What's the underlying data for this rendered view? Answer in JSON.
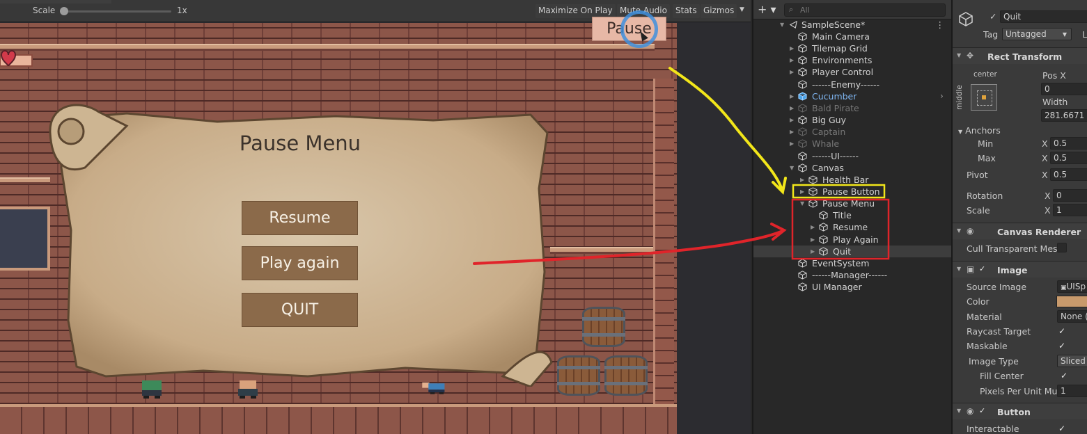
{
  "colors": {
    "accent_yellow": "#f2e61a",
    "accent_red": "#e0242a",
    "selection_blue": "#3f8fdd",
    "scroll_parchment": "#d8c3a4",
    "menu_button": "#8b6a4a"
  },
  "game_toolbar": {
    "scale_label": "Scale",
    "scale_value": "1x",
    "maximize_label": "Maximize On Play",
    "mute_label": "Mute Audio",
    "stats_label": "Stats",
    "gizmos_label": "Gizmos",
    "gizmos_dropdown": "▼"
  },
  "game": {
    "pause_button": "Pause",
    "menu_title": "Pause Menu",
    "resume": "Resume",
    "play_again": "Play again",
    "quit": "QUIT"
  },
  "hierarchy": {
    "add_label": "+ ▾",
    "search_placeholder": "All",
    "scene": "SampleScene*",
    "items": [
      {
        "label": "Main Camera"
      },
      {
        "label": "Tilemap Grid"
      },
      {
        "label": "Environments"
      },
      {
        "label": "Player Control"
      },
      {
        "label": "------Enemy------"
      },
      {
        "label": "Cucumber"
      },
      {
        "label": "Bald Pirate"
      },
      {
        "label": "Big Guy"
      },
      {
        "label": "Captain"
      },
      {
        "label": "Whale"
      },
      {
        "label": "------UI------"
      },
      {
        "label": "Canvas"
      },
      {
        "label": "Health Bar"
      },
      {
        "label": "Pause Button"
      },
      {
        "label": "Pause Menu"
      },
      {
        "label": "Title"
      },
      {
        "label": "Resume"
      },
      {
        "label": "Play Again"
      },
      {
        "label": "Quit"
      },
      {
        "label": "EventSystem"
      },
      {
        "label": "------Manager------"
      },
      {
        "label": "UI Manager"
      }
    ]
  },
  "inspector": {
    "object_name": "Quit",
    "tag_label": "Tag",
    "tag_value": "Untagged",
    "layer_short": "L",
    "rect_transform": "Rect Transform",
    "anchor_preset_h": "center",
    "anchor_preset_v": "middle",
    "pos_x_label": "Pos X",
    "pos_x_value": "0",
    "width_label": "Width",
    "width_value": "281.6671",
    "anchors_label": "Anchors",
    "min_label": "Min",
    "min_x_label": "X",
    "min_x_value": "0.5",
    "max_label": "Max",
    "max_x_label": "X",
    "max_x_value": "0.5",
    "pivot_label": "Pivot",
    "pivot_x_label": "X",
    "pivot_x_value": "0.5",
    "rotation_label": "Rotation",
    "rotation_x_label": "X",
    "rotation_x_value": "0",
    "scale_label": "Scale",
    "scale_x_label": "X",
    "scale_x_value": "1",
    "canvas_renderer": "Canvas Renderer",
    "cull_label": "Cull Transparent Mes",
    "image": "Image",
    "source_image_label": "Source Image",
    "source_image_value": "UISp",
    "color_label": "Color",
    "material_label": "Material",
    "material_value": "None (",
    "raycast_label": "Raycast Target",
    "maskable_label": "Maskable",
    "image_type_label": "Image Type",
    "image_type_value": "Sliced",
    "fill_center_label": "Fill Center",
    "ppu_label": "Pixels Per Unit Mul",
    "ppu_value": "1",
    "button": "Button",
    "interactable_label": "Interactable",
    "checkmark": "✓"
  }
}
